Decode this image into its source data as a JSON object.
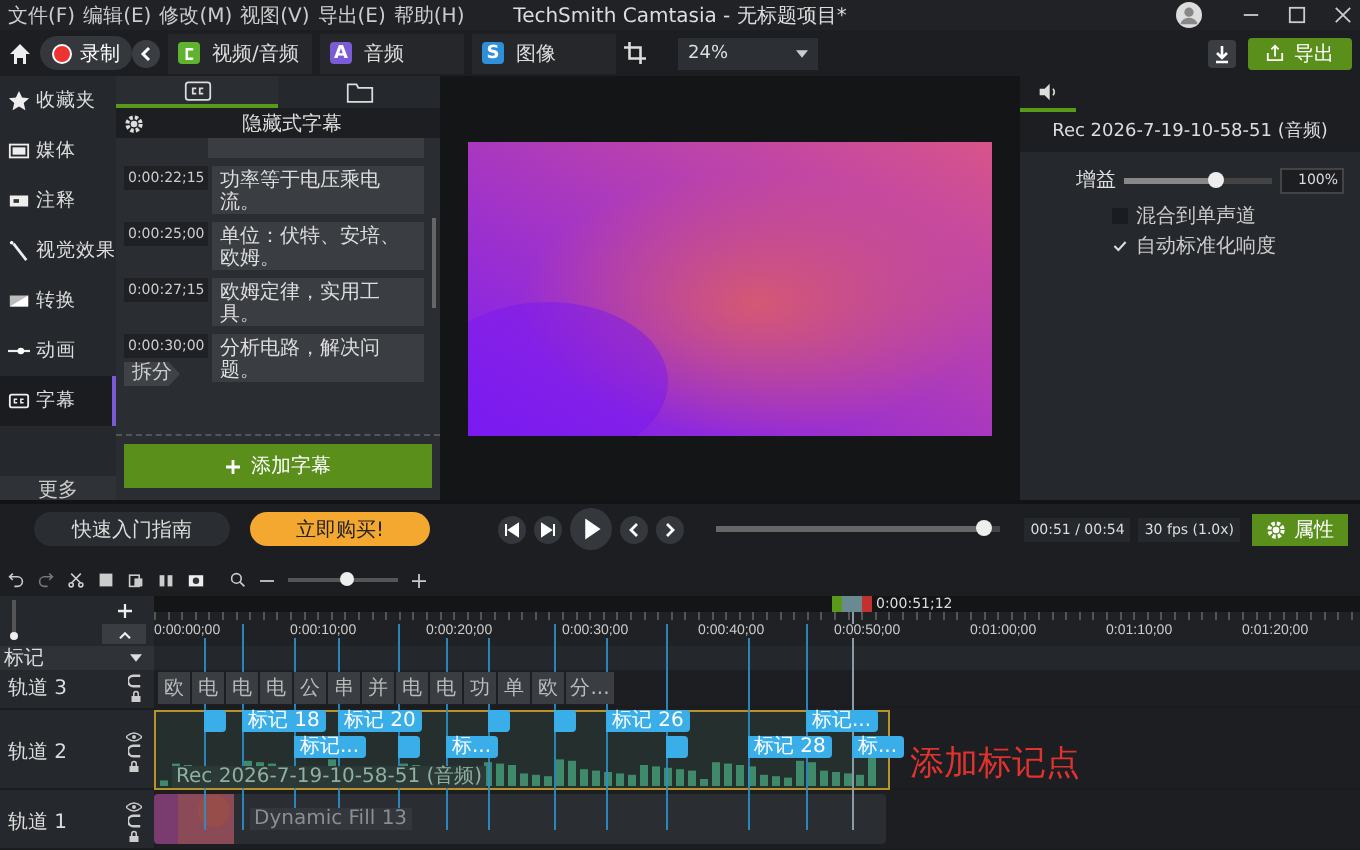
{
  "menu": [
    "文件(F)",
    "编辑(E)",
    "修改(M)",
    "视图(V)",
    "导出(E)",
    "帮助(H)"
  ],
  "window": {
    "title": "TechSmith Camtasia - 无标题项目*"
  },
  "toolbar": {
    "record": "录制",
    "tabs": [
      {
        "label": "视频/音频",
        "color": "#5fb32e"
      },
      {
        "label": "音频",
        "glyph": "A",
        "color": "#7b5cd6"
      },
      {
        "label": "图像",
        "glyph": "S",
        "color": "#2f8fd8"
      }
    ],
    "zoom": "24%",
    "export": "导出"
  },
  "sidebar": {
    "items": [
      {
        "label": "收藏夹",
        "kind": "star",
        "selected": false
      },
      {
        "label": "媒体",
        "kind": "media",
        "selected": false
      },
      {
        "label": "注释",
        "kind": "note",
        "selected": false
      },
      {
        "label": "视觉效果",
        "kind": "wand",
        "selected": false
      },
      {
        "label": "转换",
        "kind": "transition",
        "selected": false
      },
      {
        "label": "动画",
        "kind": "animation",
        "selected": false
      },
      {
        "label": "字幕",
        "kind": "cc",
        "selected": true
      }
    ],
    "more": "更多"
  },
  "captions": {
    "tabs": [
      {
        "kind": "cc",
        "selected": true
      },
      {
        "kind": "folder",
        "selected": false
      }
    ],
    "title": "隐藏式字幕",
    "items": [
      {
        "time": "0:00:22;15",
        "text": "功率等于电压乘电流。"
      },
      {
        "time": "0:00:25;00",
        "text": "单位：伏特、安培、欧姆。"
      },
      {
        "time": "0:00:27;15",
        "text": "欧姆定律，实用工具。"
      },
      {
        "time": "0:00:30;00",
        "text": "分析电路，解决问题。",
        "split": "拆分"
      }
    ],
    "add_button": "添加字幕"
  },
  "properties": {
    "title": "Rec 2026-7-19-10-58-51 (音频)",
    "gain": {
      "label": "增益",
      "level": 0.62,
      "value": "100%"
    },
    "options": [
      {
        "label": "混合到单声道",
        "checked": false
      },
      {
        "label": "自动标准化响度",
        "checked": true
      }
    ]
  },
  "playback": {
    "guide": "快速入门指南",
    "buy": "立即购买!",
    "level": 0.94,
    "time": "00:51 / 00:54",
    "fps": "30 fps (1.0x)",
    "properties": "属性"
  },
  "timeline": {
    "ruler": [
      "0:00:00;00",
      "0:00:10;00",
      "0:00:20;00",
      "0:00:30;00",
      "0:00:40;00",
      "0:00:50;00",
      "0:01:00;00",
      "0:01:10;00",
      "0:01:20;00"
    ],
    "playhead": "0:00:51;12",
    "marker_track": "标记",
    "tracks": [
      {
        "name": "轨道 3",
        "kind": "captions",
        "clips": [
          "欧",
          "电",
          "电",
          "电",
          "公",
          "串",
          "并",
          "电",
          "电",
          "功",
          "单",
          "欧",
          "分..."
        ]
      },
      {
        "name": "轨道 2",
        "kind": "audio",
        "clip": "Rec 2026-7-19-10-58-51 (音频)",
        "selected": true,
        "markers": [
          {
            "kind": "plain"
          },
          {
            "kind": "labeled",
            "label": "标记 18"
          },
          {
            "kind": "labeled",
            "label": "标记..."
          },
          {
            "kind": "labeled",
            "label": "标记 20"
          },
          {
            "kind": "plain"
          },
          {
            "kind": "labeled",
            "label": "标..."
          },
          {
            "kind": "plain"
          },
          {
            "kind": "plain"
          },
          {
            "kind": "labeled",
            "label": "标记 26"
          },
          {
            "kind": "plain"
          },
          {
            "kind": "labeled",
            "label": "标记 28"
          },
          {
            "kind": "labeled",
            "label": "标记..."
          },
          {
            "kind": "labeled",
            "label": "标..."
          }
        ]
      },
      {
        "name": "轨道 1",
        "kind": "media",
        "clip": "Dynamic Fill 13"
      }
    ]
  },
  "annotation": "添加标记点"
}
